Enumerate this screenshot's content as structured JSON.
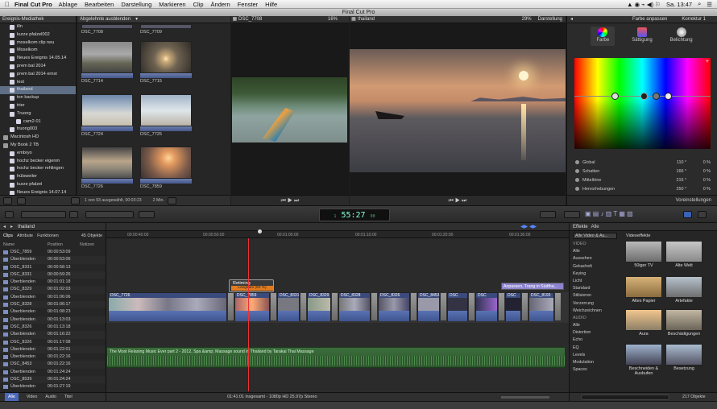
{
  "menubar": {
    "app": "Final Cut Pro",
    "items": [
      "Ablage",
      "Bearbeiten",
      "Darstellung",
      "Markieren",
      "Clip",
      "Ändern",
      "Fenster",
      "Hilfe"
    ],
    "clock": "Sa. 13:47"
  },
  "window": {
    "title": "Final Cut Pro"
  },
  "library": {
    "header": "Ereignis-Mediathek",
    "items": [
      {
        "label": "illn",
        "indent": 1,
        "sel": false
      },
      {
        "label": "kurze pfalzel002",
        "indent": 1,
        "sel": false
      },
      {
        "label": "moselkom clip neu",
        "indent": 1,
        "sel": false
      },
      {
        "label": "Moselkom",
        "indent": 1,
        "sel": false
      },
      {
        "label": "Neues Ereignis 14.05.14",
        "indent": 1,
        "sel": false
      },
      {
        "label": "prem bal 2014",
        "indent": 1,
        "sel": false
      },
      {
        "label": "prem bal 2014 ernst",
        "indent": 1,
        "sel": false
      },
      {
        "label": "test",
        "indent": 1,
        "sel": false
      },
      {
        "label": "thailand",
        "indent": 1,
        "sel": true
      },
      {
        "label": "ton backup",
        "indent": 1,
        "sel": false
      },
      {
        "label": "trier",
        "indent": 1,
        "sel": false
      },
      {
        "label": "Truong",
        "indent": 1,
        "sel": false
      },
      {
        "label": "cam2-01",
        "indent": 2,
        "sel": false
      },
      {
        "label": "truong003",
        "indent": 1,
        "sel": false
      },
      {
        "label": "Macintosh HD",
        "indent": 0,
        "sel": false
      },
      {
        "label": "My Book 2 TB",
        "indent": 0,
        "sel": false
      },
      {
        "label": "embryo",
        "indent": 1,
        "sel": false
      },
      {
        "label": "hochz becker eigenm",
        "indent": 1,
        "sel": false
      },
      {
        "label": "hochz becker rehlingen",
        "indent": 1,
        "sel": false
      },
      {
        "label": "hülsweiler",
        "indent": 1,
        "sel": false
      },
      {
        "label": "kurze pfalzel",
        "indent": 1,
        "sel": false
      },
      {
        "label": "Neues Ereignis 14.07.14",
        "indent": 1,
        "sel": false
      }
    ]
  },
  "browser": {
    "filter": "Abgelehnte ausblenden",
    "clips": [
      "DSC_7708",
      "DSC_7709",
      "DSC_7714",
      "DSC_7715",
      "DSC_7724",
      "DSC_7725",
      "DSC_7726",
      "DSC_7859"
    ],
    "status": "1 von 93 ausgewählt, 00:03:23",
    "duration": "2 Min."
  },
  "viewer1": {
    "clip": "DSC_7708",
    "zoom": "16%"
  },
  "viewer2": {
    "clip": "thailand",
    "zoom": "29%",
    "view": "Darstellung"
  },
  "inspector": {
    "title": "Farbe anpassen",
    "correction": "Korrektur 1",
    "tabs": [
      "Farbe",
      "Sättigung",
      "Belichtung"
    ],
    "rows": [
      {
        "label": "Global",
        "value": "110 °",
        "pct": "0 %"
      },
      {
        "label": "Schatten",
        "value": "166 °",
        "pct": "0 %"
      },
      {
        "label": "Mitteltöne",
        "value": "215 °",
        "pct": "0 %"
      },
      {
        "label": "Hervorhebungen",
        "value": "250 °",
        "pct": "0 %"
      }
    ],
    "presets": "Voreinstellungen"
  },
  "timecode": {
    "value": "55:27",
    "hr": "1",
    "fr": "00"
  },
  "timeline_index": {
    "tabs": [
      "Clips",
      "Attribute",
      "Funktionen"
    ],
    "count": "45 Objekte",
    "columns": [
      "Name",
      "Position",
      "Notizen"
    ],
    "rows": [
      [
        "DSC_7859",
        "00:00:53:09"
      ],
      [
        "Überblenden",
        "00:00:53:06"
      ],
      [
        "DSC_8331",
        "00:00:58:13"
      ],
      [
        "DSC_8331",
        "00:00:59:26"
      ],
      [
        "Überblenden",
        "00:01:01:18"
      ],
      [
        "DSC_8329",
        "00:01:02:03"
      ],
      [
        "Überblenden",
        "00:01:06:06"
      ],
      [
        "DSC_8328",
        "00:01:06:17"
      ],
      [
        "Überblenden",
        "00:01:08:23"
      ],
      [
        "Überblenden",
        "00:01:13:03"
      ],
      [
        "DSC_8326",
        "00:01:13:18"
      ],
      [
        "Überblenden",
        "00:01:16:22"
      ],
      [
        "DSC_8326",
        "00:01:17:08"
      ],
      [
        "Überblenden",
        "00:01:22:01"
      ],
      [
        "Überblenden",
        "00:01:22:16"
      ],
      [
        "DSC_8453",
        "00:01:22:16"
      ],
      [
        "Überblenden",
        "00:01:24:24"
      ],
      [
        "DSC_8539",
        "00:01:24:24"
      ],
      [
        "Überblenden",
        "00:01:27:19"
      ]
    ],
    "filters": [
      "Alle",
      "Video",
      "Audio",
      "Titel"
    ]
  },
  "timeline": {
    "project": "thailand",
    "ticks": [
      "00:00:40:00",
      "00:00:50:00",
      "00:01:00:00",
      "00:01:10:00",
      "00:01:20:00",
      "00:01:30:00",
      "00:01:40:00"
    ],
    "retiming": "Retiming",
    "speed": "Langsam (50 %)",
    "title_clip": "Anpassen, Trang in Südtha...",
    "clips": [
      "DSC_7726",
      "DSC_7859",
      "DSC_8331",
      "DSC_8329",
      "DSC_8328",
      "DSC_8326",
      "DSC_8453",
      "DSC",
      "DSC",
      "DSC",
      "DSC_8193"
    ],
    "music": "The Most Relaxing Music Ever part 2 - 2012, Spa &amp; Massage sound in Thailand by Tarakai Thai Massage",
    "status": "01:41:01 insgesamt - 1080p HD 25.97p Stereo"
  },
  "effects": {
    "header": "Effekte",
    "all_label": "Alle",
    "dropdown": "Alle Video & Au...",
    "section_video": "VIDEO",
    "section_audio": "AUDIO",
    "categories_video": [
      "Alle",
      "Aussehen",
      "Gekachelt",
      "Keying",
      "Licht",
      "Standard",
      "Stilisieren",
      "Verzerrung",
      "Weichzeichnen"
    ],
    "categories_audio": [
      "Alle",
      "Distortion",
      "Echo",
      "EQ",
      "Levels",
      "Modulation",
      "Spaces"
    ],
    "grid_title": "Videoeffekte",
    "items": [
      "50iger TV",
      "Alte Welt",
      "Altes Papier",
      "Artefakte",
      "Aura",
      "Beschädigungen",
      "Beschneiden & Ausbufen",
      "Besetzung"
    ],
    "count": "217 Objekte"
  }
}
